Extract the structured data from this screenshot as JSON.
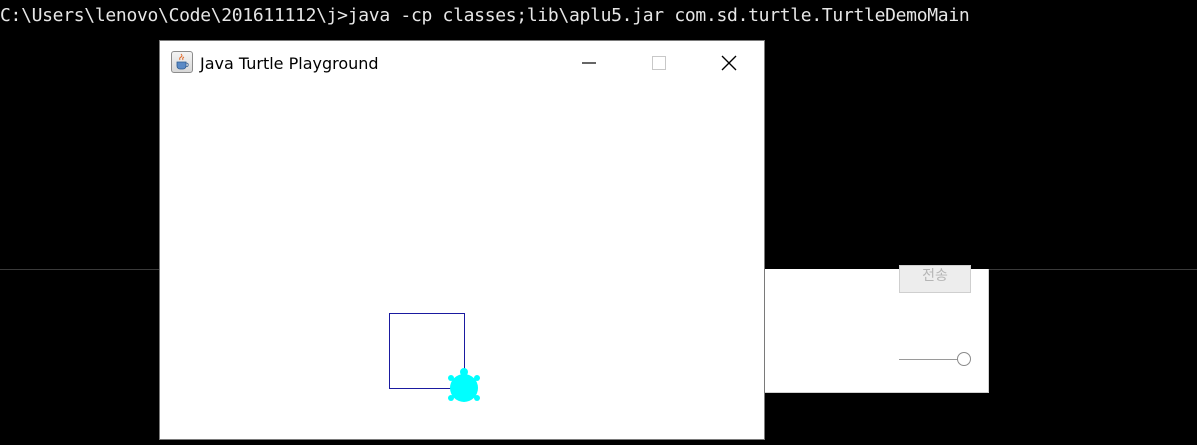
{
  "console": {
    "command_line": "C:\\Users\\lenovo\\Code\\201611112\\j>java -cp classes;lib\\aplu5.jar com.sd.turtle.TurtleDemoMain"
  },
  "window": {
    "title": "Java Turtle Playground",
    "icon": "java-cup-icon",
    "controls": {
      "minimize_icon": "minimize-icon",
      "maximize_icon": "maximize-icon",
      "close_icon": "close-icon"
    }
  },
  "turtle_canvas": {
    "background": "#ffffff",
    "square_color": "#1a1aa0",
    "turtle_color": "#00ffff",
    "turtle_icon": "turtle-icon"
  },
  "background_dialog": {
    "button_label": "전송",
    "slider": "slider"
  },
  "colors": {
    "console_bg": "#000000",
    "console_text": "#e6e6e6"
  }
}
